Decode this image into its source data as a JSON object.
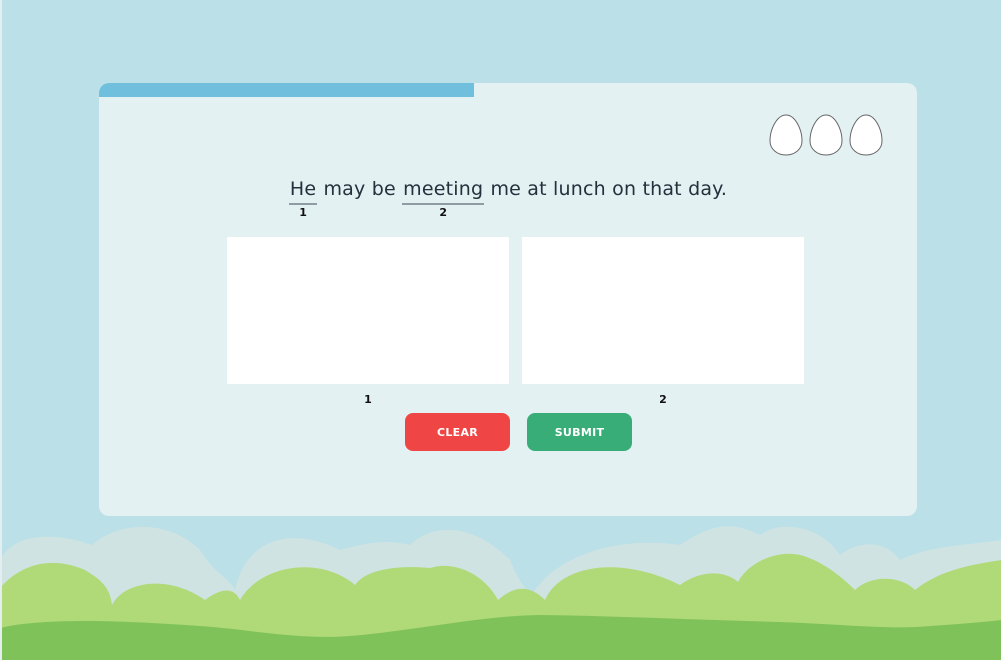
{
  "progress": {
    "fraction": 0.459,
    "color": "#70bfdc"
  },
  "lives": {
    "count": 3,
    "icon": "egg-icon",
    "fill": "#ffffff",
    "stroke": "#666666"
  },
  "sentence": {
    "segments": [
      {
        "text": "He",
        "target": true,
        "index": "1"
      },
      {
        "text": " may be ",
        "target": false
      },
      {
        "text": "meeting",
        "target": true,
        "index": "2"
      },
      {
        "text": " me at lunch on that day.",
        "target": false
      }
    ]
  },
  "answers": [
    {
      "label": "1"
    },
    {
      "label": "2"
    }
  ],
  "buttons": {
    "clear": "CLEAR",
    "submit": "SUBMIT"
  },
  "colors": {
    "sky": "#bbe0e8",
    "card": "#e3f1f3",
    "clear": "#f04545",
    "submit": "#39ad77",
    "grass_back": "#cfe3e2",
    "grass_mid": "#b0da78",
    "grass_front": "#80c25a"
  }
}
